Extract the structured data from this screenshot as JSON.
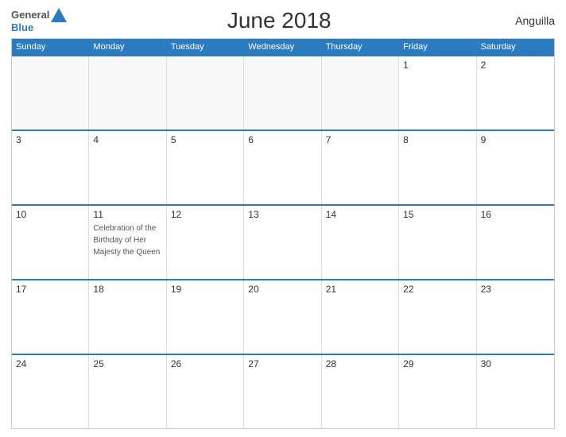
{
  "header": {
    "logo_general": "General",
    "logo_blue": "Blue",
    "title": "June 2018",
    "country": "Anguilla"
  },
  "days_of_week": [
    "Sunday",
    "Monday",
    "Tuesday",
    "Wednesday",
    "Thursday",
    "Friday",
    "Saturday"
  ],
  "weeks": [
    [
      {
        "num": "",
        "empty": true
      },
      {
        "num": "",
        "empty": true
      },
      {
        "num": "",
        "empty": true
      },
      {
        "num": "",
        "empty": true
      },
      {
        "num": "",
        "empty": true
      },
      {
        "num": "1",
        "empty": false,
        "event": ""
      },
      {
        "num": "2",
        "empty": false,
        "event": ""
      }
    ],
    [
      {
        "num": "3",
        "empty": false,
        "event": ""
      },
      {
        "num": "4",
        "empty": false,
        "event": ""
      },
      {
        "num": "5",
        "empty": false,
        "event": ""
      },
      {
        "num": "6",
        "empty": false,
        "event": ""
      },
      {
        "num": "7",
        "empty": false,
        "event": ""
      },
      {
        "num": "8",
        "empty": false,
        "event": ""
      },
      {
        "num": "9",
        "empty": false,
        "event": ""
      }
    ],
    [
      {
        "num": "10",
        "empty": false,
        "event": ""
      },
      {
        "num": "11",
        "empty": false,
        "event": "Celebration of the Birthday of Her Majesty the Queen"
      },
      {
        "num": "12",
        "empty": false,
        "event": ""
      },
      {
        "num": "13",
        "empty": false,
        "event": ""
      },
      {
        "num": "14",
        "empty": false,
        "event": ""
      },
      {
        "num": "15",
        "empty": false,
        "event": ""
      },
      {
        "num": "16",
        "empty": false,
        "event": ""
      }
    ],
    [
      {
        "num": "17",
        "empty": false,
        "event": ""
      },
      {
        "num": "18",
        "empty": false,
        "event": ""
      },
      {
        "num": "19",
        "empty": false,
        "event": ""
      },
      {
        "num": "20",
        "empty": false,
        "event": ""
      },
      {
        "num": "21",
        "empty": false,
        "event": ""
      },
      {
        "num": "22",
        "empty": false,
        "event": ""
      },
      {
        "num": "23",
        "empty": false,
        "event": ""
      }
    ],
    [
      {
        "num": "24",
        "empty": false,
        "event": ""
      },
      {
        "num": "25",
        "empty": false,
        "event": ""
      },
      {
        "num": "26",
        "empty": false,
        "event": ""
      },
      {
        "num": "27",
        "empty": false,
        "event": ""
      },
      {
        "num": "28",
        "empty": false,
        "event": ""
      },
      {
        "num": "29",
        "empty": false,
        "event": ""
      },
      {
        "num": "30",
        "empty": false,
        "event": ""
      }
    ]
  ]
}
